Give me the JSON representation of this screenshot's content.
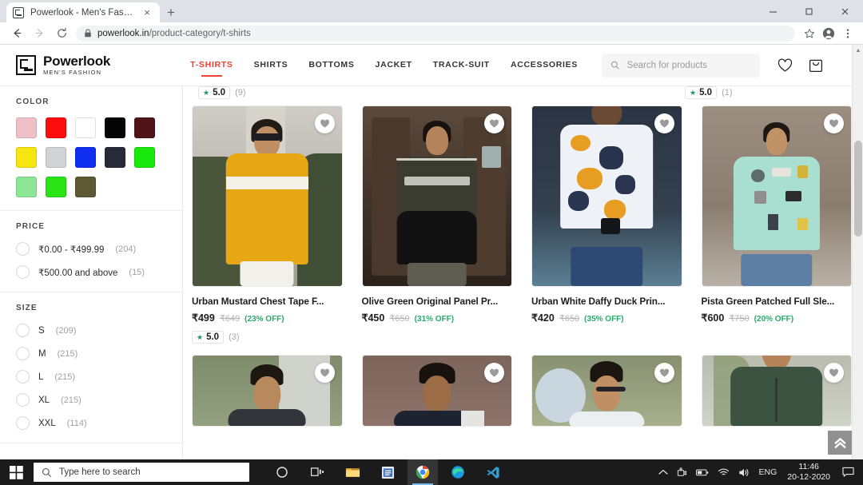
{
  "browser": {
    "tab_title": "Powerlook - Men's Fashion",
    "tab_close": "×",
    "new_tab": "+",
    "window_minimize": "—",
    "window_maximize": "❐",
    "window_close": "✕",
    "url_host": "powerlook.in",
    "url_path": "/product-category/t-shirts"
  },
  "site": {
    "brand_name": "Powerlook",
    "brand_tagline": "MEN'S FASHION",
    "nav": [
      {
        "label": "T-SHIRTS",
        "active": true
      },
      {
        "label": "SHIRTS",
        "active": false
      },
      {
        "label": "BOTTOMS",
        "active": false
      },
      {
        "label": "JACKET",
        "active": false
      },
      {
        "label": "TRACK-SUIT",
        "active": false
      },
      {
        "label": "ACCESSORIES",
        "active": false
      }
    ],
    "search_placeholder": "Search for products",
    "search_value": ""
  },
  "filters": {
    "color": {
      "title": "COLOR",
      "swatches": [
        {
          "name": "pink",
          "hex": "#f0c0c8"
        },
        {
          "name": "red",
          "hex": "#fb0d0d"
        },
        {
          "name": "white",
          "hex": "#ffffff"
        },
        {
          "name": "black",
          "hex": "#050505"
        },
        {
          "name": "maroon",
          "hex": "#4e1418"
        },
        {
          "name": "yellow",
          "hex": "#f7e510"
        },
        {
          "name": "grey",
          "hex": "#d2d3d4"
        },
        {
          "name": "blue",
          "hex": "#0f2ef0"
        },
        {
          "name": "navy",
          "hex": "#272b38"
        },
        {
          "name": "green",
          "hex": "#18e80b"
        },
        {
          "name": "pista-green",
          "hex": "#8de695"
        },
        {
          "name": "lime-green",
          "hex": "#2ae317"
        },
        {
          "name": "olive",
          "hex": "#5d5935"
        }
      ]
    },
    "price": {
      "title": "PRICE",
      "options": [
        {
          "label": "₹0.00 - ₹499.99",
          "count": "(204)"
        },
        {
          "label": "₹500.00 and above",
          "count": "(15)"
        }
      ]
    },
    "size": {
      "title": "SIZE",
      "options": [
        {
          "label": "S",
          "count": "(209)"
        },
        {
          "label": "M",
          "count": "(215)"
        },
        {
          "label": "L",
          "count": "(215)"
        },
        {
          "label": "XL",
          "count": "(215)"
        },
        {
          "label": "XXL",
          "count": "(114)"
        }
      ]
    }
  },
  "top_strip": [
    {
      "star": "★",
      "value": "5.0",
      "count": "(9)"
    },
    {
      "star": "★",
      "value": "5.0",
      "count": "(1)"
    }
  ],
  "products": [
    {
      "title": "Urban Mustard Chest Tape F...",
      "price": "₹499",
      "mrp": "₹649",
      "discount": "(23% OFF)",
      "rating": "5.0",
      "rating_count": "(3)",
      "star": "★"
    },
    {
      "title": "Olive Green Original Panel Pr...",
      "price": "₹450",
      "mrp": "₹650",
      "discount": "(31% OFF)",
      "rating": "",
      "rating_count": "",
      "star": ""
    },
    {
      "title": "Urban White Daffy Duck Prin...",
      "price": "₹420",
      "mrp": "₹650",
      "discount": "(35% OFF)",
      "rating": "",
      "rating_count": "",
      "star": ""
    },
    {
      "title": "Pista Green Patched Full Sle...",
      "price": "₹600",
      "mrp": "₹750",
      "discount": "(20% OFF)",
      "rating": "",
      "rating_count": "",
      "star": ""
    }
  ],
  "scroll_top_label": "«",
  "taskbar": {
    "search_placeholder": "Type here to search",
    "language": "ENG",
    "time": "11:46",
    "date": "20-12-2020"
  },
  "colors": {
    "accent": "#ef4136",
    "discount_green": "#2aa96b",
    "rating_green": "#1c9a5e"
  }
}
